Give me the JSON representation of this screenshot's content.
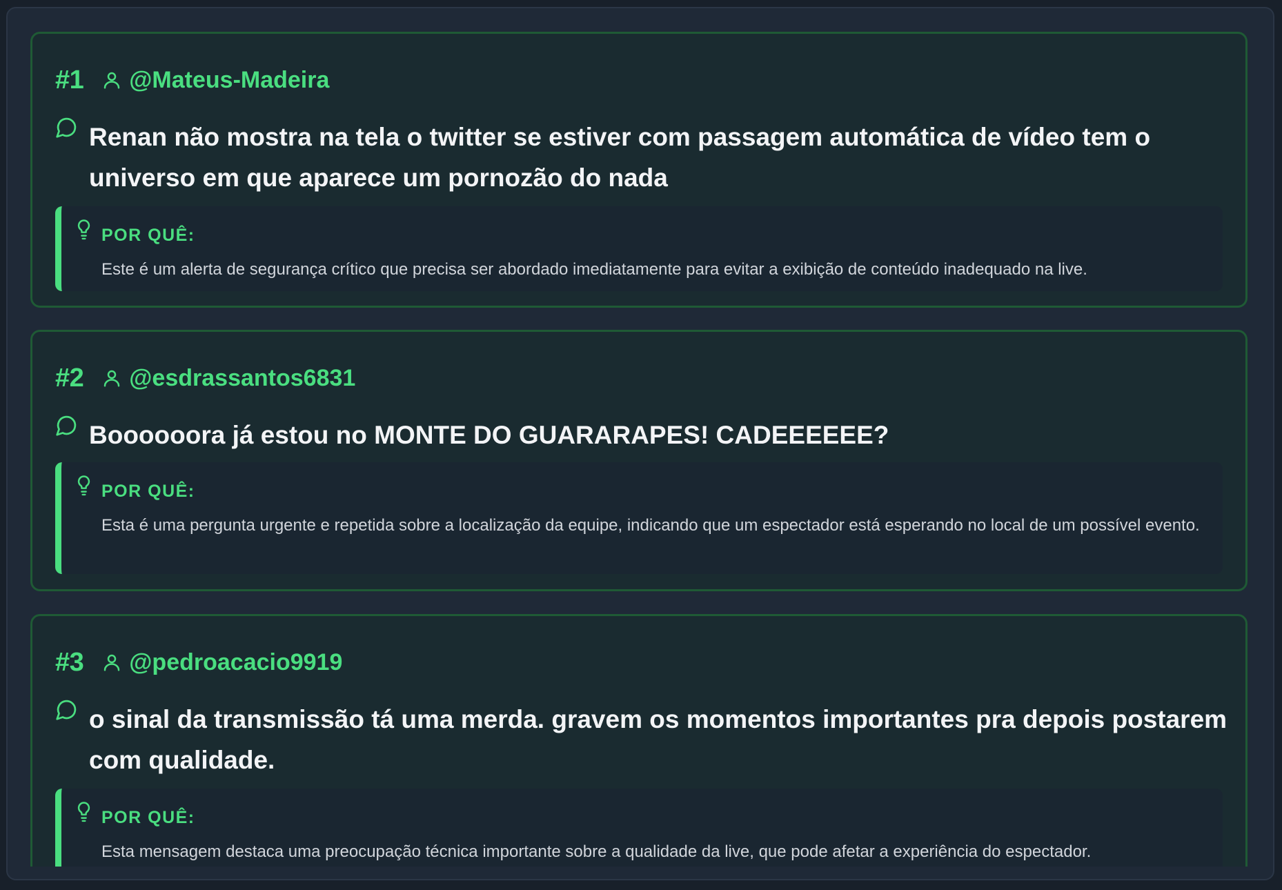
{
  "reason_label": "POR QUÊ:",
  "accent_color": "#4ade80",
  "items": [
    {
      "rank": "#1",
      "author": "@Mateus-Madeira",
      "message": "Renan não mostra na tela o twitter se estiver com passagem automática de vídeo tem o universo em que aparece um pornozão do nada",
      "reason": "Este é um alerta de segurança crítico que precisa ser abordado imediatamente para evitar a exibição de conteúdo inadequado na live."
    },
    {
      "rank": "#2",
      "author": "@esdrassantos6831",
      "message": "Boooooora já estou no MONTE DO GUARARAPES! CADEEEEEE?",
      "reason": "Esta é uma pergunta urgente e repetida sobre a localização da equipe, indicando que um espectador está esperando no local de um possível evento."
    },
    {
      "rank": "#3",
      "author": "@pedroacacio9919",
      "message": "o sinal da transmissão tá uma merda. gravem os momentos importantes pra depois postarem com qualidade.",
      "reason": "Esta mensagem destaca uma preocupação técnica importante sobre a qualidade da live, que pode afetar a experiência do espectador."
    }
  ]
}
